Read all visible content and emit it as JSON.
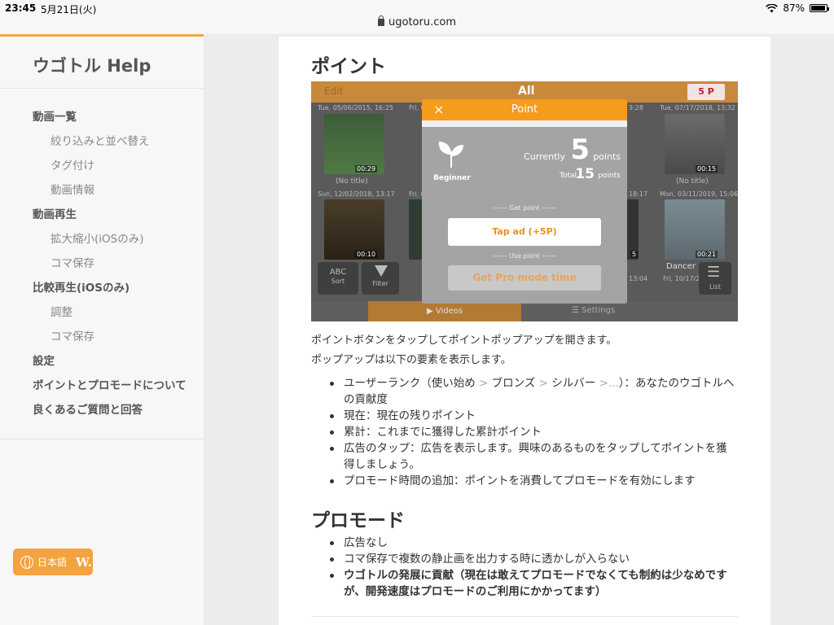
{
  "status": {
    "time": "23:45",
    "date": "5月21日(火)",
    "battery": "87%",
    "battery_level": 0.87
  },
  "browser": {
    "url": "ugotoru.com"
  },
  "sidebar": {
    "brand": "ウゴトル Help",
    "items": [
      {
        "label": "動画一覧",
        "level": "top"
      },
      {
        "label": "絞り込みと並べ替え",
        "level": "sub"
      },
      {
        "label": "タグ付け",
        "level": "sub"
      },
      {
        "label": "動画情報",
        "level": "sub"
      },
      {
        "label": "動画再生",
        "level": "top"
      },
      {
        "label": "拡大縮小(iOSのみ)",
        "level": "sub"
      },
      {
        "label": "コマ保存",
        "level": "sub"
      },
      {
        "label": "比較再生(iOSのみ)",
        "level": "top"
      },
      {
        "label": "調整",
        "level": "sub"
      },
      {
        "label": "コマ保存",
        "level": "sub"
      },
      {
        "label": "設定",
        "level": "top"
      },
      {
        "label": "ポイントとプロモードについて",
        "level": "top"
      },
      {
        "label": "良くあるご質問と回答",
        "level": "top"
      }
    ],
    "language_button": {
      "label": "日本語",
      "brand": "W."
    }
  },
  "main": {
    "heading_point": "ポイント",
    "screenshot": {
      "edit": "Edit",
      "title": "All",
      "points_badge": "5 P",
      "dates": [
        "Tue, 05/06/2015, 16:25",
        "Fri, 0",
        "3:28",
        "Tue, 07/17/2018, 13:32",
        "Sun, 12/02/2018, 13:17",
        "Fri, 0",
        "18:17",
        "Mon, 03/11/2019, 15:06",
        "13:04",
        "Fri, 10/17/20"
      ],
      "durations": [
        "00:29",
        "00:15",
        "00:10",
        "5",
        "00:21"
      ],
      "no_title": "(No title)",
      "dancer": "Dancer",
      "sort_icon_text": "ABC",
      "sort": "Sort",
      "filter": "Filter",
      "list": "List",
      "videos_tab": "Videos",
      "settings_tab": "Settings",
      "popup": {
        "title": "Point",
        "close": "×",
        "rank": "Beginner",
        "currently_label": "Currently",
        "current_points": "5",
        "points_word": "points",
        "total_label": "Total",
        "total_points": "15",
        "get_point_label": "------ Get point ------",
        "tap_ad": "Tap ad (+5P)",
        "use_point_label": "------ Use point ------",
        "pro_mode": "Get Pro mode time"
      }
    },
    "para1": "ポイントボタンをタップしてポイントポップアップを開きます。",
    "para2": "ポップアップは以下の要素を表示します。",
    "bullets1": {
      "b1_text1": "ユーザーランク（使い始め",
      "sep": ">",
      "b1_text2": "ブロンズ",
      "b1_text3": "シルバー",
      "b1_dots": ">...",
      "b1_text4": "）：あなたのウゴトルへの貢献度",
      "b2": "現在：現在の残りポイント",
      "b3": "累計：これまでに獲得した累計ポイント",
      "b4": "広告のタップ：広告を表示します。興味のあるものをタップしてポイントを獲得しましょう。",
      "b5": "プロモード時間の追加：ポイントを消費してプロモードを有効にします"
    },
    "heading_pro": "プロモード",
    "bullets2": [
      "広告なし",
      "コマ保存で複数の静止画を出力する時に透かしが入らない",
      "ウゴトルの発展に貢献（現在は敢えてプロモードでなくても制約は少なめですが、開発速度はプロモードのご利用にかかってます）"
    ]
  },
  "colors": {
    "accent": "#f4a340",
    "popup_header": "#f59c1c",
    "sidebar_bg": "#f7f7f7"
  }
}
